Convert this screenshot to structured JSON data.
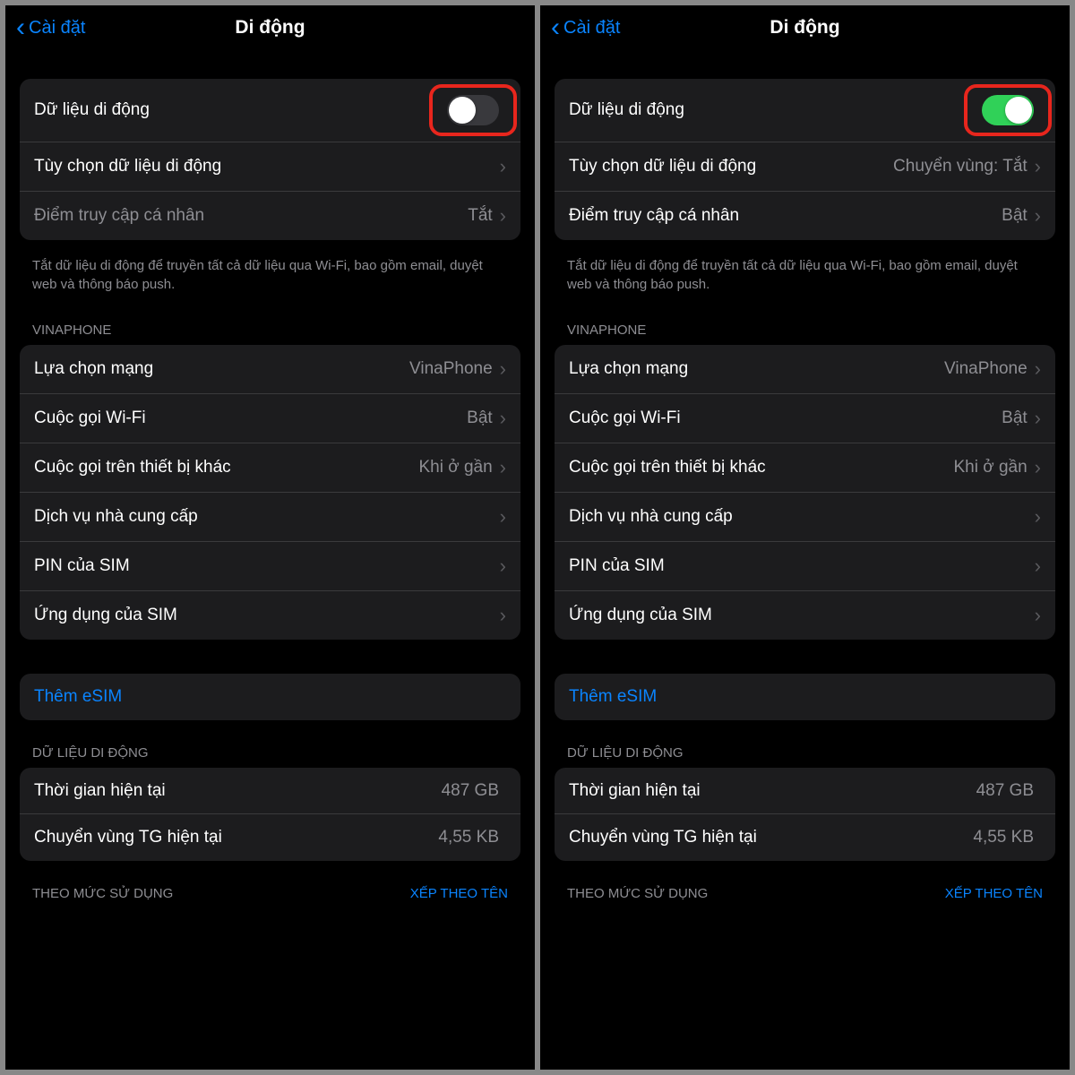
{
  "nav": {
    "back": "Cài đặt",
    "title": "Di động"
  },
  "left": {
    "mobile_data": {
      "label": "Dữ liệu di động",
      "on": false
    },
    "data_options": {
      "label": "Tùy chọn dữ liệu di động",
      "value": ""
    },
    "hotspot": {
      "label": "Điểm truy cập cá nhân",
      "value": "Tắt"
    }
  },
  "right": {
    "mobile_data": {
      "label": "Dữ liệu di động",
      "on": true
    },
    "data_options": {
      "label": "Tùy chọn dữ liệu di động",
      "value": "Chuyển vùng: Tắt"
    },
    "hotspot": {
      "label": "Điểm truy cập cá nhân",
      "value": "Bật"
    }
  },
  "footer_note": "Tắt dữ liệu di động để truyền tất cả dữ liệu qua Wi-Fi, bao gồm email, duyệt web và thông báo push.",
  "carrier_header": "VINAPHONE",
  "carrier": {
    "network_selection": {
      "label": "Lựa chọn mạng",
      "value": "VinaPhone"
    },
    "wifi_calling": {
      "label": "Cuộc gọi Wi-Fi",
      "value": "Bật"
    },
    "other_devices": {
      "label": "Cuộc gọi trên thiết bị khác",
      "value": "Khi ở gần"
    },
    "carrier_services": {
      "label": "Dịch vụ nhà cung cấp"
    },
    "sim_pin": {
      "label": "PIN của SIM"
    },
    "sim_apps": {
      "label": "Ứng dụng của SIM"
    }
  },
  "esim": {
    "add": "Thêm eSIM"
  },
  "usage_header": "DỮ LIỆU DI ĐỘNG",
  "usage": {
    "current_period": {
      "label": "Thời gian hiện tại",
      "value": "487 GB"
    },
    "roaming": {
      "label": "Chuyển vùng TG hiện tại",
      "value": "4,55 KB"
    }
  },
  "by_usage_header": {
    "left": "THEO MỨC SỬ DỤNG",
    "right": "XẾP THEO TÊN"
  }
}
